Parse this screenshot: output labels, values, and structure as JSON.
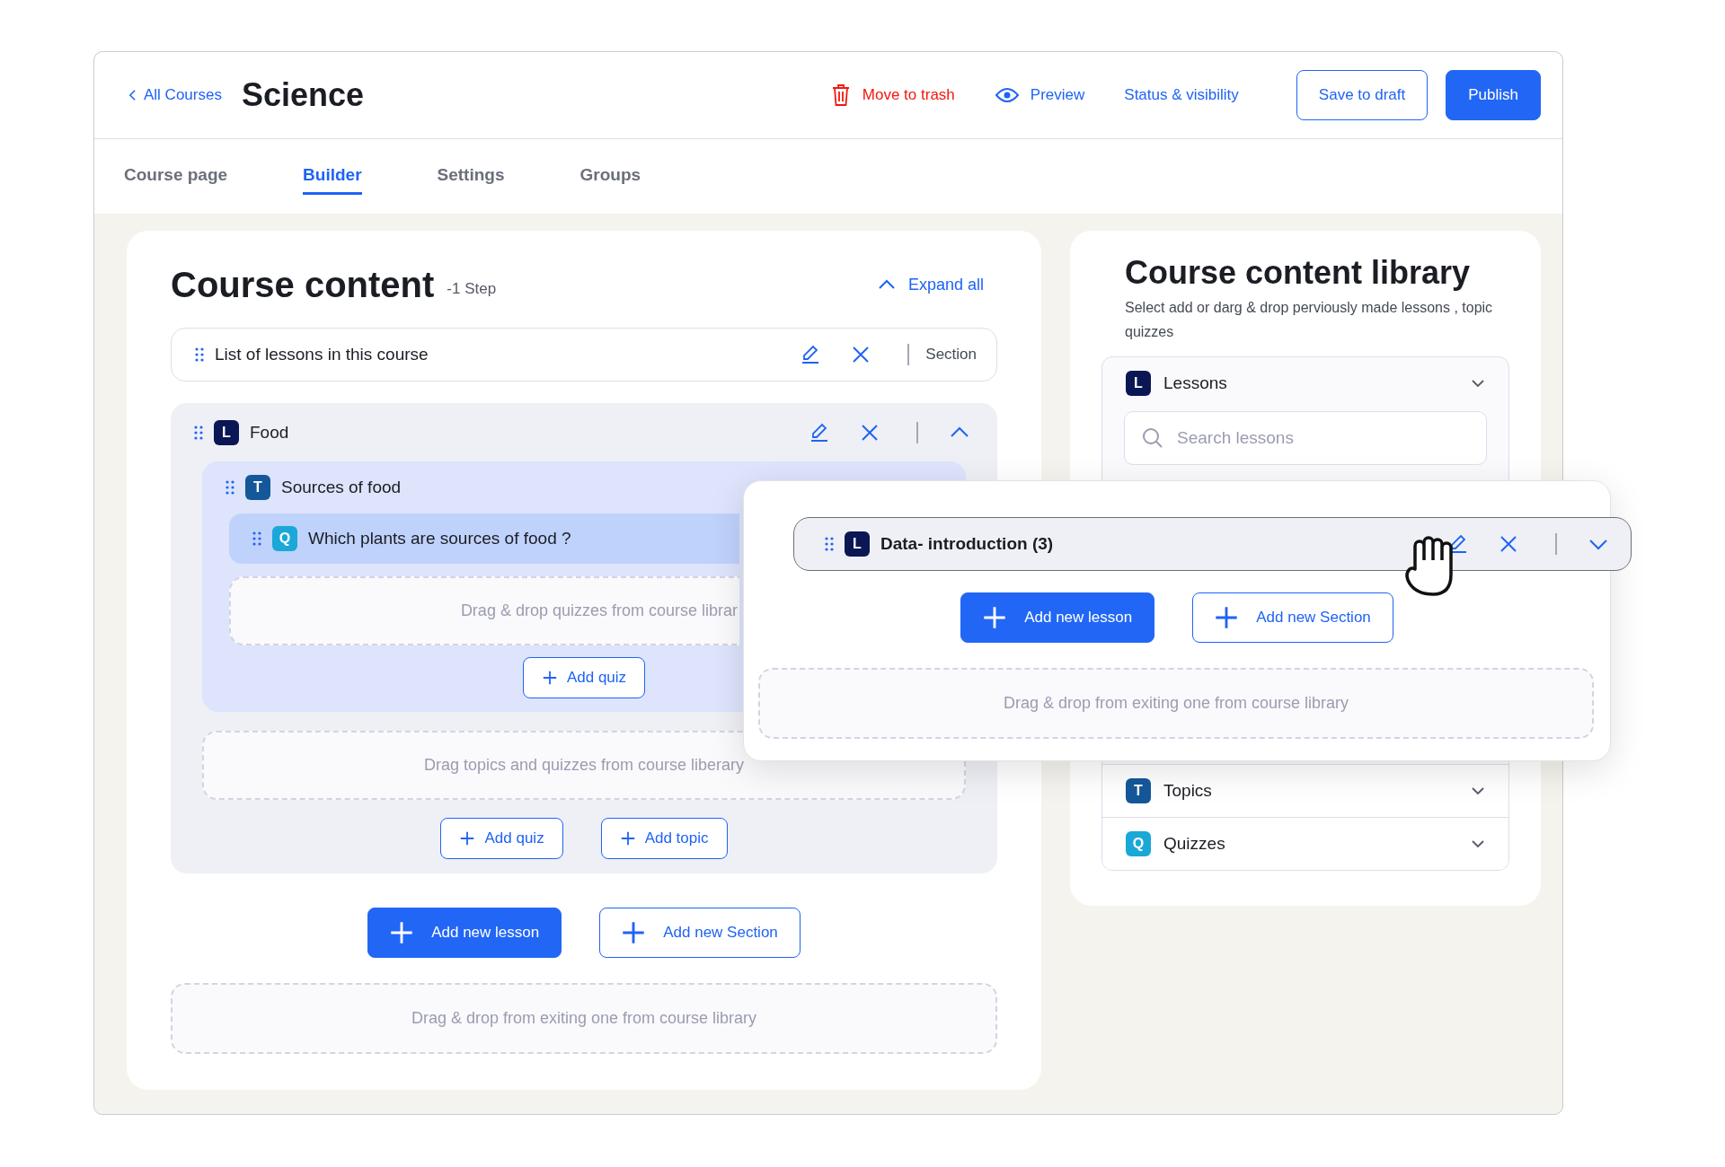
{
  "header": {
    "back_link": "All Courses",
    "title": "Science",
    "actions": [
      {
        "label": "Move to trash",
        "kind": "danger"
      },
      {
        "label": "Preview",
        "kind": "preview"
      },
      {
        "label": "Status & visibility",
        "kind": "link"
      },
      {
        "label": "Save to draft",
        "kind": "outline"
      },
      {
        "label": "Publish",
        "kind": "primary"
      }
    ]
  },
  "tabs": [
    {
      "label": "Course page",
      "selected": false
    },
    {
      "label": "Builder",
      "selected": true
    },
    {
      "label": "Settings",
      "selected": false
    },
    {
      "label": "Groups",
      "selected": false
    }
  ],
  "course_content": {
    "title": "Course content",
    "step": "-1 Step",
    "expand_all": "Expand all",
    "section": {
      "label": "List of lessons in this course",
      "tag": "Section"
    },
    "lesson": {
      "badge": "L",
      "kind": "lesson",
      "title": "Food",
      "expanded": true,
      "topic": {
        "badge": "T",
        "kind": "topic",
        "title": "Sources of food",
        "quiz": {
          "badge": "Q",
          "kind": "quiz",
          "title": "Which plants are sources of food ?"
        },
        "drop_hint": "Drag & drop quizzes from course librar",
        "add_button": "Add quiz"
      },
      "drop_hint": "Drag topics and quizzes from course liberary",
      "buttons": [
        "Add quiz",
        "Add topic"
      ]
    },
    "buttons": [
      {
        "label": "Add new lesson",
        "kind": "primary"
      },
      {
        "label": "Add new Section",
        "kind": "outline"
      }
    ],
    "drop_hint": "Drag & drop from exiting one from course library"
  },
  "library": {
    "title": "Course content library",
    "subtitle": "Select add or darg & drop perviously made lessons , topic quizzes",
    "categories": [
      {
        "badge": "L",
        "kind": "lesson",
        "label": "Lessons",
        "search_placeholder": "Search lessons"
      },
      {
        "badge": "T",
        "kind": "topic",
        "label": "Topics"
      },
      {
        "badge": "Q",
        "kind": "quiz",
        "label": "Quizzes"
      }
    ]
  },
  "drag_preview": {
    "badge": "L",
    "kind": "lesson",
    "title": "Data- introduction (3)",
    "expanded": false,
    "buttons": [
      {
        "label": "Add new lesson",
        "kind": "primary"
      },
      {
        "label": "Add new Section",
        "kind": "outline"
      }
    ],
    "drop_hint": "Drag & drop from exiting one from course library"
  }
}
